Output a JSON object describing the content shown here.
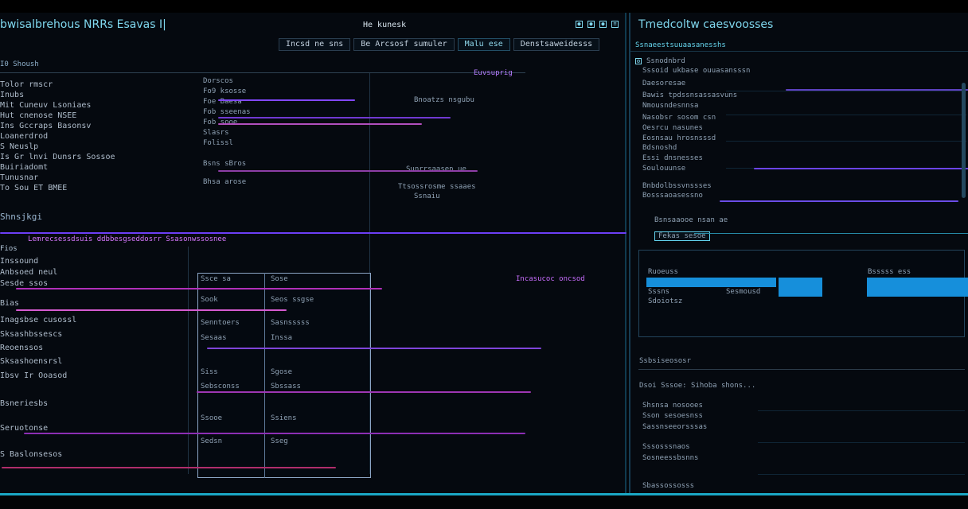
{
  "window": {
    "left_title": "bwisalbrehous NRRs Esavas I|",
    "center_label": "He kunesk",
    "right_title": "Tmedcoltw caesvoosses",
    "status_icons": [
      "status-dot-icon",
      "status-dot-icon",
      "status-dot-icon",
      "menu-icon"
    ]
  },
  "toolbar": {
    "items": [
      "Incsd ne sns",
      "Be Arcsosf sumuler",
      "Malu ese",
      "Denstsaweidesss"
    ]
  },
  "main": {
    "section_one": "I0 Shoush",
    "left_lines": [
      "Tolor rmscr",
      "Inubs",
      "Mit Cuneuv Lsoniaes",
      "Hut cnenose NSEE",
      "Ins Gccraps Basonsv",
      "Loanerdrod",
      "S Neuslp",
      "Is Gr lnvi Dunsrs Sossoe",
      "Buiriadomt",
      "Tunusnar",
      "To Sou ET BMEE",
      "Shnsjkgi"
    ],
    "mid_lines": [
      "Dorscos",
      "Fo9 ksosse",
      "Foe Baesa",
      "Fob sseenas",
      "Fob sooe",
      "Slasrs",
      "Folissl",
      "Bsns sBros",
      "Bhsa arose"
    ],
    "right_notes": [
      "Euvsuprig",
      "Bnoatzs nsgubu",
      "Sunrrsaasen ue",
      "Ttsossrosme ssaaes",
      "Ssnaiu"
    ],
    "divider_label": "Lemrecsessdsuis ddbbesgseddosrr Ssasonwssosnee"
  },
  "lower": {
    "section": "Fios",
    "left_lines": [
      "Inssound",
      "Anbsoed neul",
      "Sesde ssos",
      "Bias",
      "Inagsbse cusossl",
      "Sksashbssescs",
      "Reoenssos",
      "Sksashoensrsl",
      "Ibsv Ir Ooasod",
      "Bsneriesbs",
      "Seruotonse",
      "S Baslonsesos"
    ],
    "mid_lines": [
      "Ssce sa",
      "Sook",
      "Senntoers",
      "Sesaas",
      "Siss",
      "Sebsconss",
      "Ssooe",
      "Sedsn"
    ],
    "grid_lines": [
      "Sose",
      "Seos ssgse",
      "Sasnsssss",
      "Inssa",
      "Sgose",
      "Sbssass",
      "Ssiens",
      "Sseg"
    ],
    "callout": "Incasucoc oncsod"
  },
  "side": {
    "top_link": "Ssnaeestsuuaasanesshs",
    "section_header": "Ssnodnbrd",
    "items": [
      "Sssoid ukbase ouuasansssn",
      "Daesoresae",
      "Bawis tpdssnsassasvuns",
      "Nmousndesnnsa",
      "Nasobsr sosom csn",
      "Oesrcu nasunes",
      "Eosnsau hrosnsssd",
      "Bdsnoshd",
      "Essi dnsnesses",
      "Soulouunse",
      "Bnbdolbssvnssses",
      "Bosssaoasessno"
    ],
    "mid_label": "Bsnsaaooe nsan ae",
    "tag": "Fekas sesoe",
    "selected": {
      "label": "Ruoeuss",
      "rows": [
        "Sssns",
        "Sdoiotsz",
        "Sesmousd"
      ],
      "right_label": "Bsssss ess"
    },
    "events_header": "Ssbsiseososr",
    "events": [
      "Dsoi Sssoe: Sihoba shons...",
      "Shsnsa nosooes",
      "Sson sesoesnss",
      "Sassnseeorsssas",
      "Sssosssnaos",
      "Sosneessbsnns",
      "Sbassossosss"
    ]
  }
}
